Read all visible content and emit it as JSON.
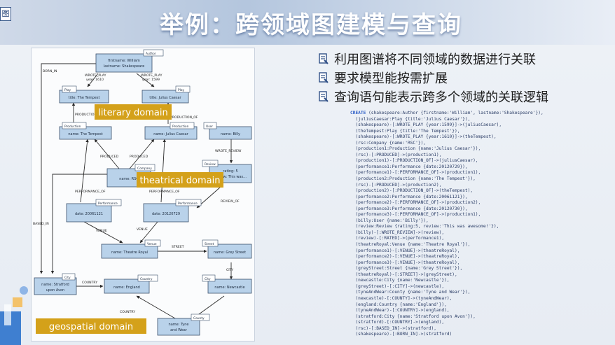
{
  "corner_tag": "图",
  "title": "举例：跨领域图建模与查询",
  "bullets": [
    "利用图谱将不同领域的数据进行关联",
    "要求模型能按需扩展",
    "查询语句能表示跨多个领域的关联逻辑"
  ],
  "diagram": {
    "nodes": {
      "shakespeare": {
        "tag": "Author",
        "line1": "firstname: William",
        "line2": "lastname: Shakespeare"
      },
      "tempest_play": {
        "tag": "Play",
        "line1": "title: The Tempest"
      },
      "caesar_play": {
        "tag": "Play",
        "line1": "title: Julius Caesar"
      },
      "prod_tempest": {
        "tag": "Production",
        "line1": "name: The Tempest"
      },
      "prod_caesar": {
        "tag": "Production",
        "line1": "name: Julius Caesar"
      },
      "user_billy": {
        "tag": "User",
        "line1": "name: Billy"
      },
      "company_rsc": {
        "tag": "Company",
        "line1": "name: RSC"
      },
      "review": {
        "tag": "Review",
        "line1": "rating: 5",
        "line2": "review: This was..."
      },
      "perf1": {
        "tag": "Performance",
        "line1": "date: 20061121"
      },
      "perf2": {
        "tag": "Performance",
        "line1": "date: 20120729"
      },
      "venue": {
        "tag": "Venue",
        "line1": "name: Theatre Royal"
      },
      "street": {
        "tag": "Street",
        "line1": "name: Grey Street"
      },
      "city_stratford": {
        "tag": "City",
        "line1": "name: Stratford",
        "line2": "upon Avon"
      },
      "country": {
        "tag": "Country",
        "line1": "name: England"
      },
      "city_newcastle": {
        "tag": "City",
        "line1": "name: Newcastle"
      },
      "county": {
        "tag": "County",
        "line1": "name: Tyne",
        "line2": "and Wear"
      }
    },
    "edges": {
      "born_in": "BORN_IN",
      "wrote_play_1": "WROTE_PLAY",
      "year_1": "year: 1610",
      "wrote_play_2": "WROTE_PLAY",
      "year_2": "year: 1599",
      "production_of_1": "PRODUCTION_OF",
      "production_of_2": "PRODUCTION_OF",
      "produced_1": "PRODUCED",
      "produced_2": "PRODUCED",
      "wrote_review": "WROTE_REVIEW",
      "performance_of_1": "PERFORMANCE_OF",
      "performance_of_2": "PERFORMANCE_OF",
      "review_of": "REVIEW_OF",
      "based_in": "BASED_IN",
      "venue_1": "VENUE",
      "venue_2": "VENUE",
      "street_rel": "STREET",
      "city_rel": "CITY",
      "country_1": "COUNTRY",
      "country_2": "COUNTRY"
    },
    "domains": {
      "literary": "literary domain",
      "theatrical": "theatrical domain",
      "geospatial": "geospatial domain"
    },
    "colors": {
      "node_fill": "#b9d2ea",
      "node_stroke": "#3a4f6b",
      "domain_label": "#d4a11a"
    }
  },
  "code": [
    {
      "kw": "CREATE",
      "text": " (shakespeare:Author {firstname:'William', lastname:'Shakespeare'}),"
    },
    {
      "text": "  (juliusCaesar:Play {title:'Julius Caesar'}),"
    },
    {
      "text": "  (shakespeare)-[:WROTE_PLAY {year:1599}]->(juliusCaesar),"
    },
    {
      "text": "  (theTempest:Play {title:'The Tempest'}),"
    },
    {
      "text": "  (shakespeare)-[:WROTE_PLAY {year:1610}]->(theTempest),"
    },
    {
      "text": "  (rsc:Company {name:'RSC'}),"
    },
    {
      "text": "  (production1:Production {name:'Julius Caesar'}),"
    },
    {
      "text": "  (rsc)-[:PRODUCED]->(production1),"
    },
    {
      "text": "  (production1)-[:PRODUCTION_OF]->(juliusCaesar),"
    },
    {
      "text": "  (performance1:Performance {date:20120729}),"
    },
    {
      "text": "  (performance1)-[:PERFORMANCE_OF]->(production1),"
    },
    {
      "text": "  (production2:Production {name:'The Tempest'}),"
    },
    {
      "text": "  (rsc)-[:PRODUCED]->(production2),"
    },
    {
      "text": "  (production2)-[:PRODUCTION_OF]->(theTempest),"
    },
    {
      "text": "  (performance2:Performance {date:20061121}),"
    },
    {
      "text": "  (performance2)-[:PERFORMANCE_OF]->(production2),"
    },
    {
      "text": "  (performance3:Performance {date:20120730}),"
    },
    {
      "text": "  (performance3)-[:PERFORMANCE_OF]->(production1),"
    },
    {
      "text": "  (billy:User {name:'Billy'}),"
    },
    {
      "text": "  (review:Review {rating:5, review:'This was awesome!'}),"
    },
    {
      "text": "  (billy)-[:WROTE_REVIEW]->(review),"
    },
    {
      "text": "  (review)-[:RATED]->(performance1),"
    },
    {
      "text": "  (theatreRoyal:Venue {name:'Theatre Royal'}),"
    },
    {
      "text": "  (performance1)-[:VENUE]->(theatreRoyal),"
    },
    {
      "text": "  (performance2)-[:VENUE]->(theatreRoyal),"
    },
    {
      "text": "  (performance3)-[:VENUE]->(theatreRoyal),"
    },
    {
      "text": "  (greyStreet:Street {name:'Grey Street'}),"
    },
    {
      "text": "  (theatreRoyal)-[:STREET]->(greyStreet),"
    },
    {
      "text": "  (newcastle:City {name:'Newcastle'}),"
    },
    {
      "text": "  (greyStreet)-[:CITY]->(newcastle),"
    },
    {
      "text": "  (tyneAndWear:County {name:'Tyne and Wear'}),"
    },
    {
      "text": "  (newcastle)-[:COUNTY]->(tyneAndWear),"
    },
    {
      "text": "  (england:Country {name:'England'}),"
    },
    {
      "text": "  (tyneAndWear)-[:COUNTRY]->(england),"
    },
    {
      "text": "  (stratford:City {name:'Stratford upon Avon'}),"
    },
    {
      "text": "  (stratford)-[:COUNTRY]->(england),"
    },
    {
      "text": "  (rsc)-[:BASED_IN]->(stratford),"
    },
    {
      "text": "  (shakespeare)-[:BORN_IN]->(stratford)"
    }
  ]
}
